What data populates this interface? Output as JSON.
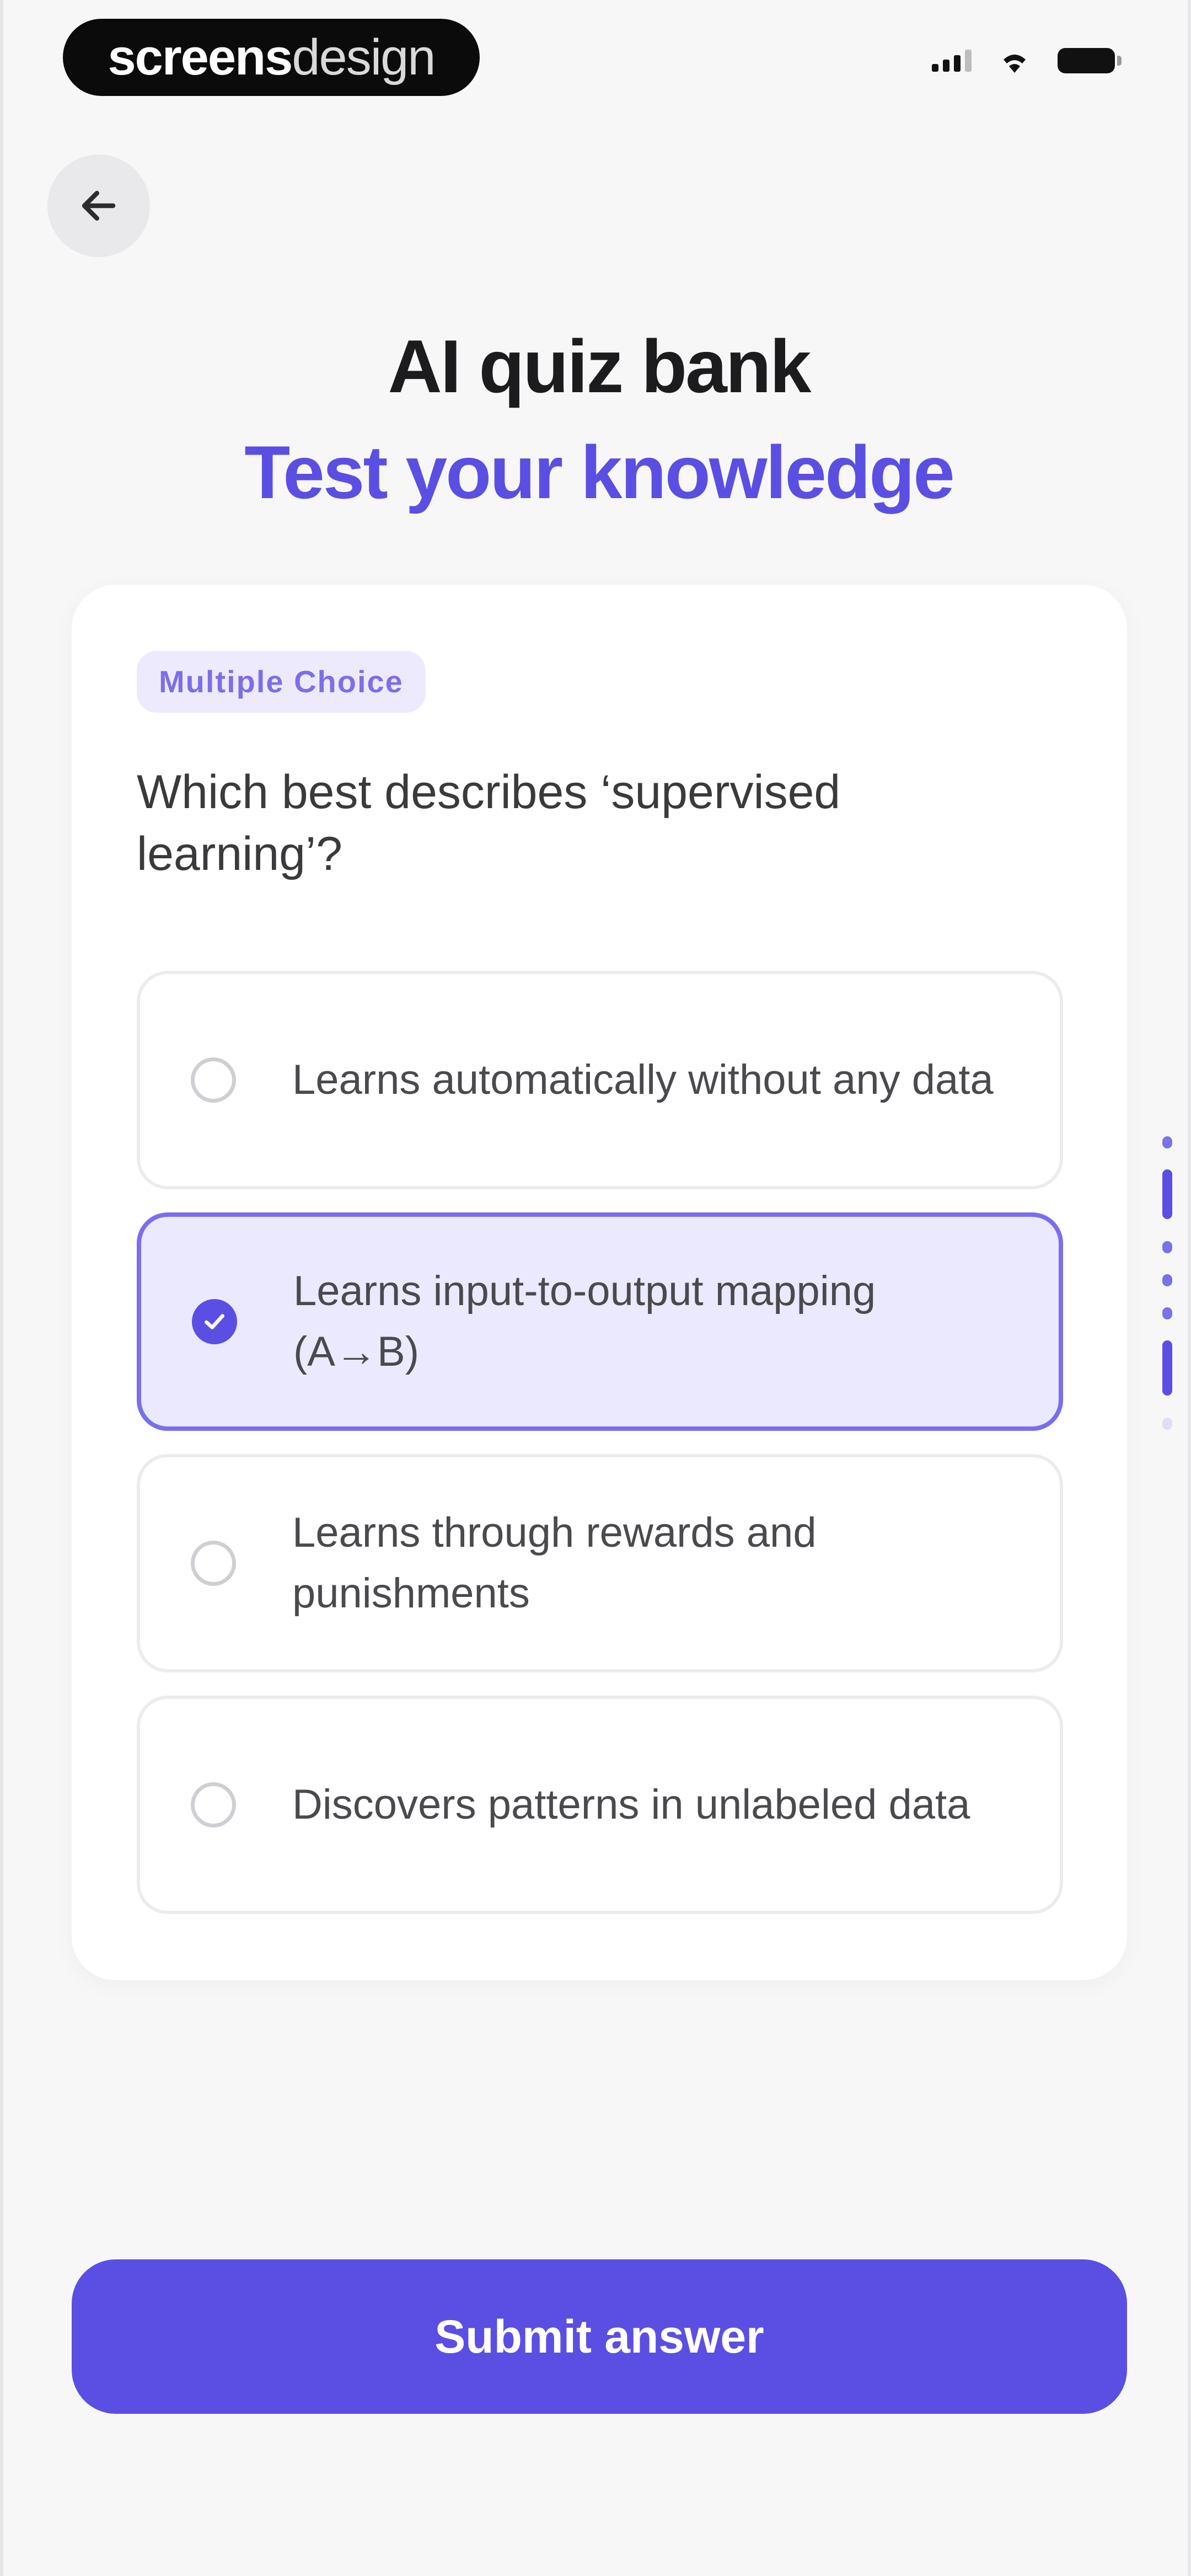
{
  "status_bar": {
    "brand_bold": "screens",
    "brand_light": "design"
  },
  "header": {
    "back_icon": "arrow-left-icon",
    "title": "AI quiz bank",
    "subtitle": "Test your knowledge"
  },
  "card": {
    "badge": "Multiple Choice",
    "question": "Which best describes ‘supervised learning’?",
    "options": [
      {
        "label": "Learns automatically without any data",
        "selected": false
      },
      {
        "label": "Learns input-to-output mapping (A→B)",
        "selected": true
      },
      {
        "label": "Learns through rewards and punishments",
        "selected": false
      },
      {
        "label": "Discovers patterns in unlabeled data",
        "selected": false
      }
    ]
  },
  "footer": {
    "submit_label": "Submit answer"
  },
  "colors": {
    "accent": "#5b4fe3",
    "accent_soft": "#ebe9fd",
    "background": "#f7f7f8"
  }
}
